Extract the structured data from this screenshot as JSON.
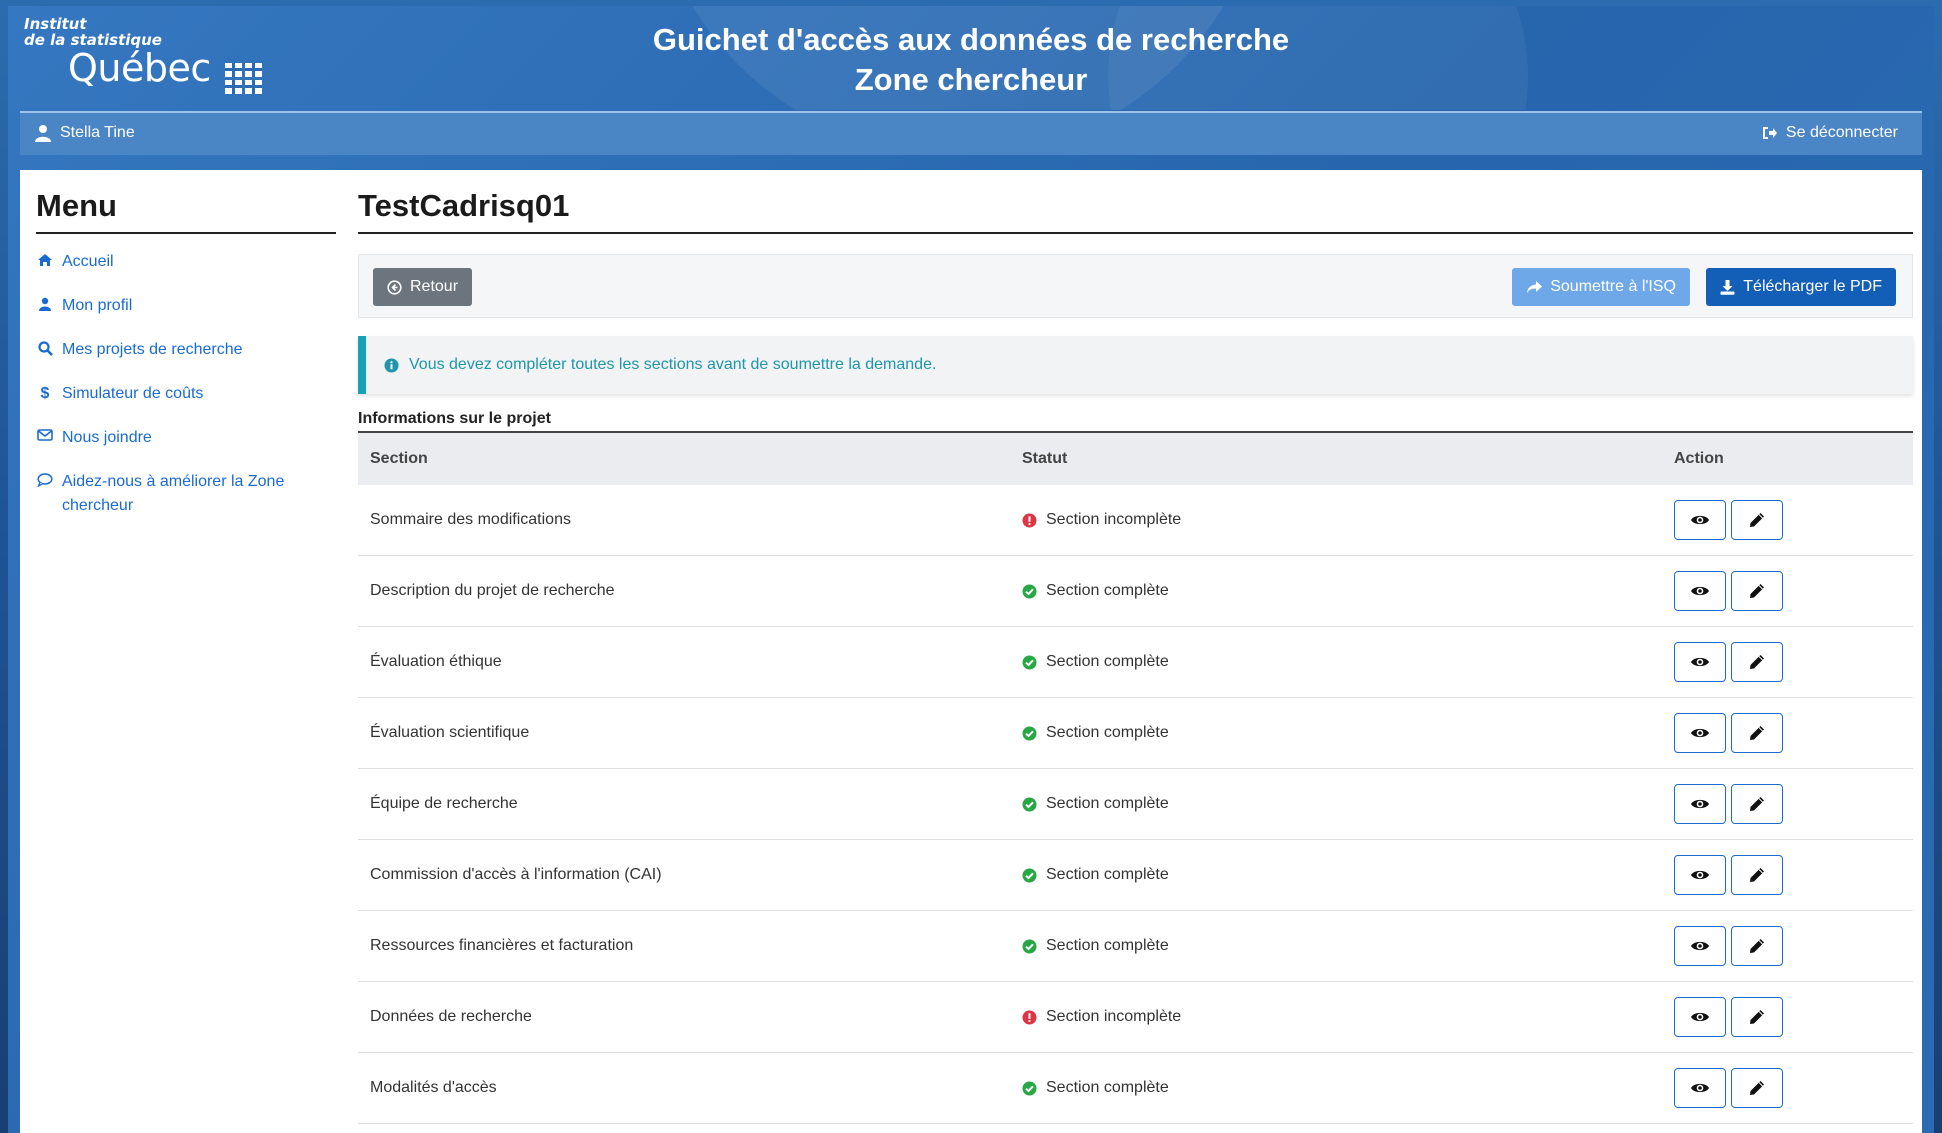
{
  "logo": {
    "line1": "Institut",
    "line2": "de la statistique",
    "line3": "Québec"
  },
  "header": {
    "title_line1": "Guichet d'accès aux données de recherche",
    "title_line2": "Zone chercheur"
  },
  "userbar": {
    "user_name": "Stella Tine",
    "logout_label": "Se déconnecter"
  },
  "sidebar": {
    "title": "Menu",
    "items": [
      {
        "label": "Accueil",
        "icon": "home-icon"
      },
      {
        "label": "Mon profil",
        "icon": "user-icon"
      },
      {
        "label": "Mes projets de recherche",
        "icon": "search-icon"
      },
      {
        "label": "Simulateur de coûts",
        "icon": "dollar-icon"
      },
      {
        "label": "Nous joindre",
        "icon": "envelope-icon"
      },
      {
        "label": "Aidez-nous à améliorer la Zone chercheur",
        "icon": "comment-icon"
      }
    ]
  },
  "project": {
    "title": "TestCadrisq01"
  },
  "toolbar": {
    "back_label": "Retour",
    "submit_label": "Soumettre à l'ISQ",
    "pdf_label": "Télécharger le PDF"
  },
  "alert": {
    "message": "Vous devez compléter toutes les sections avant de soumettre la demande."
  },
  "table": {
    "caption": "Informations sur le projet",
    "headers": {
      "section": "Section",
      "status": "Statut",
      "action": "Action"
    },
    "rows": [
      {
        "section": "Sommaire des modifications",
        "status": "Section incomplète",
        "complete": false
      },
      {
        "section": "Description du projet de recherche",
        "status": "Section complète",
        "complete": true
      },
      {
        "section": "Évaluation éthique",
        "status": "Section complète",
        "complete": true
      },
      {
        "section": "Évaluation scientifique",
        "status": "Section complète",
        "complete": true
      },
      {
        "section": "Équipe de recherche",
        "status": "Section complète",
        "complete": true
      },
      {
        "section": "Commission d'accès à l'information (CAI)",
        "status": "Section complète",
        "complete": true
      },
      {
        "section": "Ressources financières et facturation",
        "status": "Section complète",
        "complete": true
      },
      {
        "section": "Données de recherche",
        "status": "Section incomplète",
        "complete": false
      },
      {
        "section": "Modalités d'accès",
        "status": "Section complète",
        "complete": true
      }
    ]
  },
  "colors": {
    "link": "#1a6bd1",
    "complete": "#28a745",
    "incomplete": "#dc3545",
    "header_blue": "#2a6bb4",
    "alert_info": "#17a2b8"
  }
}
